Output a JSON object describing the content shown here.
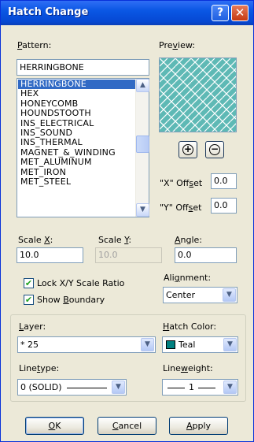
{
  "window": {
    "title": "Hatch Change"
  },
  "titlebar": {
    "help_glyph": "?",
    "close_glyph": "✕"
  },
  "pattern": {
    "label_pre": "",
    "label_key": "P",
    "label_post": "attern:",
    "value": "HERRINGBONE",
    "items": [
      "HERRINGBONE",
      "HEX",
      "HONEYCOMB",
      "HOUNDSTOOTH",
      "INS_ELECTRICAL",
      "INS_SOUND",
      "INS_THERMAL",
      "MAGNET_&_WINDING",
      "MET_ALUMINUM",
      "MET_IRON",
      "MET_STEEL"
    ],
    "selected_index": 0
  },
  "preview": {
    "label_pre": "Pre",
    "label_key": "v",
    "label_post": "iew:",
    "fill_color": "#5EB9B5",
    "zoom_in_glyph": "+",
    "zoom_out_glyph": "−"
  },
  "x_offset": {
    "label_pre": "\"X\" Off",
    "label_key": "s",
    "label_post": "et",
    "value": "0.0"
  },
  "y_offset": {
    "label_pre": "\"Y\" Off",
    "label_key": "s",
    "label_post": "et",
    "value": "0.0"
  },
  "scale_x": {
    "label_pre": "Scale ",
    "label_key": "X",
    "label_post": ":",
    "value": "10.0"
  },
  "scale_y": {
    "label_pre": "Scale ",
    "label_key": "Y",
    "label_post": ":",
    "value": "10.0"
  },
  "angle": {
    "label_pre": "",
    "label_key": "A",
    "label_post": "ngle:",
    "value": "0.0"
  },
  "lock_ratio": {
    "label": "Lock X/Y Scale Ratio",
    "checked": true,
    "check_glyph": "✔"
  },
  "show_boundary": {
    "label_pre": "Show ",
    "label_key": "B",
    "label_post": "oundary",
    "checked": true,
    "check_glyph": "✔"
  },
  "alignment": {
    "label_pre": "Ali",
    "label_key": "g",
    "label_post": "nment:",
    "value": "Center"
  },
  "layer": {
    "label_pre": "",
    "label_key": "L",
    "label_post": "ayer:",
    "value": "* 25"
  },
  "hatch_color": {
    "label_pre": "",
    "label_key": "H",
    "label_post": "atch Color:",
    "value": "Teal",
    "color": "#008080"
  },
  "linetype": {
    "label_pre": "Line",
    "label_key": "t",
    "label_post": "ype:",
    "value": "0 (SOLID)"
  },
  "lineweight": {
    "label_pre": "Line",
    "label_key": "w",
    "label_post": "eight:",
    "value": "1"
  },
  "buttons": {
    "ok": {
      "key": "O",
      "rest": "K"
    },
    "cancel": {
      "key": "C",
      "rest": "ancel"
    },
    "apply": {
      "key": "A",
      "rest": "pply"
    }
  },
  "colors": {
    "title_bar": "#0A57E4",
    "dialog_bg": "#ECE9D8",
    "selection": "#316AC5",
    "field_border": "#7F9DB9"
  }
}
